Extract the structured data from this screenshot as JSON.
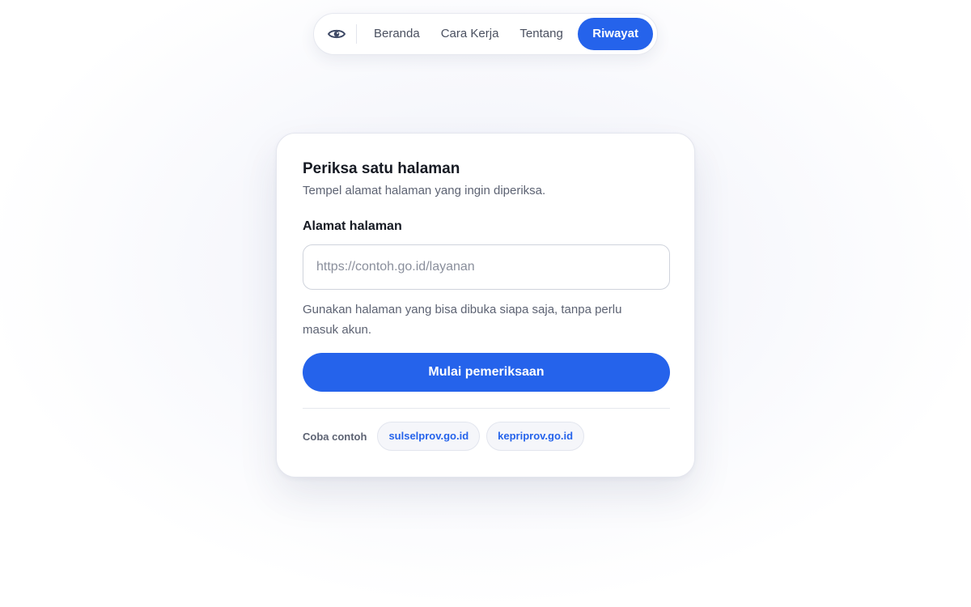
{
  "nav": {
    "icon": "eye-icon",
    "links": [
      "Beranda",
      "Cara Kerja",
      "Tentang"
    ],
    "active": "Riwayat",
    "accent_color": "#2563eb"
  },
  "card": {
    "title": "Periksa satu halaman",
    "subtitle": "Tempel alamat halaman yang ingin diperiksa.",
    "field_label": "Alamat halaman",
    "input": {
      "value": "",
      "placeholder": "https://contoh.go.id/layanan"
    },
    "hint": "Gunakan halaman yang bisa dibuka siapa saja, tanpa perlu masuk akun.",
    "submit_label": "Mulai pemeriksaan",
    "examples_label": "Coba contoh",
    "examples": [
      "sulselprov.go.id",
      "kepriprov.go.id"
    ]
  }
}
